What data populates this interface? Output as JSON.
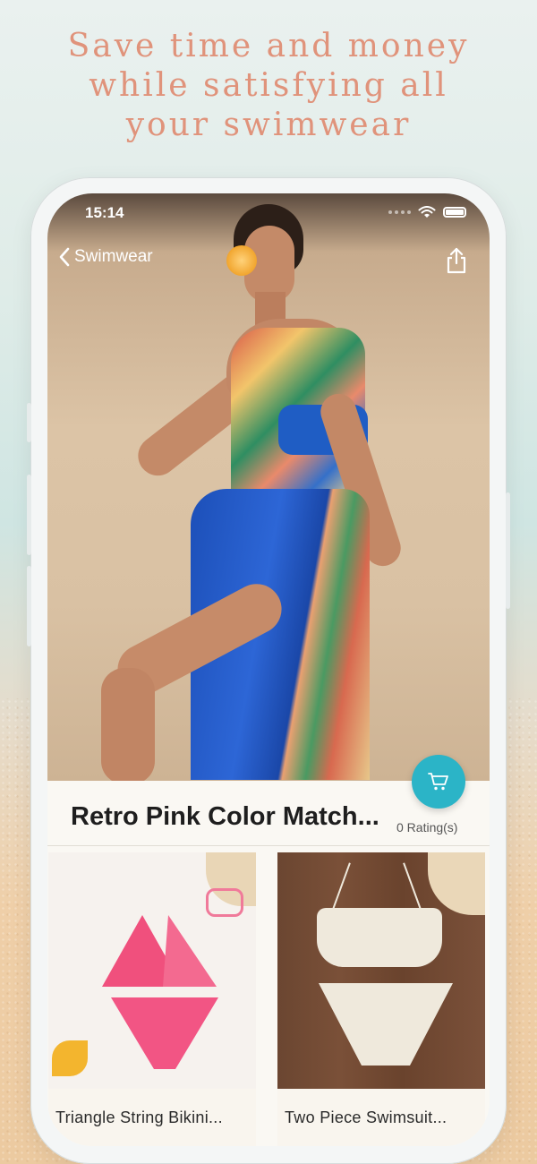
{
  "promo": {
    "headline_lines": [
      "Save time and money",
      "while satisfying all",
      "your swimwear"
    ]
  },
  "status_bar": {
    "time": "15:14"
  },
  "nav": {
    "back_label": "Swimwear"
  },
  "product": {
    "title": "Retro Pink Color Match...",
    "rating_text": "0 Rating(s)"
  },
  "related": [
    {
      "label": "Triangle String Bikini..."
    },
    {
      "label": "Two Piece Swimsuit..."
    }
  ],
  "colors": {
    "headline": "#e0937b",
    "accent_cart": "#2bb4c7",
    "title_text": "#1e1e1e"
  },
  "icons": [
    "chevron-left-icon",
    "share-icon",
    "wifi-icon",
    "battery-icon",
    "cart-icon"
  ]
}
